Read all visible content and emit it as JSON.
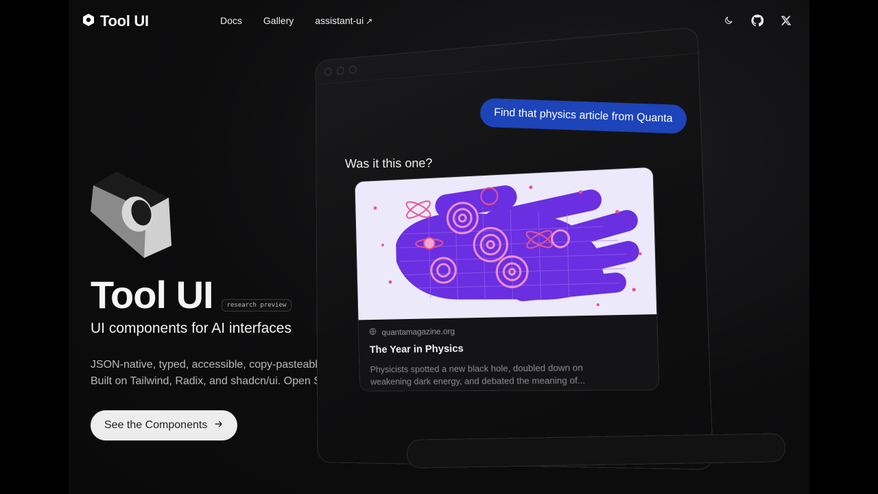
{
  "header": {
    "brand": "Tool UI",
    "nav": [
      {
        "label": "Docs"
      },
      {
        "label": "Gallery"
      },
      {
        "label": "assistant-ui",
        "external_icon": "arrow-up-right-icon"
      }
    ],
    "icons": [
      "moon-icon",
      "github-icon",
      "x-icon"
    ]
  },
  "hero": {
    "title": "Tool UI",
    "badge": "research preview",
    "subtitle": "UI components for AI interfaces",
    "description_line1": "JSON-native, typed, accessible, copy-pasteable.",
    "description_line2": "Built on Tailwind, Radix, and shadcn/ui. Open Source.",
    "cta_label": "See the Components",
    "cta_icon": "arrow-right-icon"
  },
  "chat": {
    "user_message": "Find that physics article from Quanta",
    "assistant_message": "Was it this one?",
    "card": {
      "source": "quantamagazine.org",
      "title": "The Year in Physics",
      "description": "Physicists spotted a new black hole, doubled down on weakening dark energy, and debated the meaning of..."
    }
  },
  "colors": {
    "accent_bubble": "#1d44b8",
    "cta_bg": "#ededed",
    "illustration_purple": "#6a2fe0",
    "illustration_pink": "#f08fd0"
  }
}
